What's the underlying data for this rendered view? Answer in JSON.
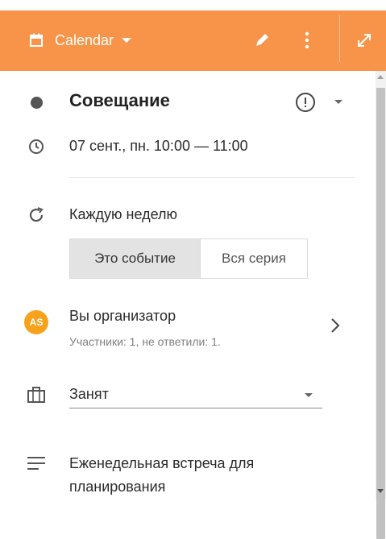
{
  "header": {
    "calendar_label": "Calendar",
    "accent_color": "#f7944a"
  },
  "event": {
    "title": "Совещание",
    "datetime": "07 сент., пн. 10:00 — 11:00",
    "repeat": "Каждую неделю",
    "scope_options": [
      "Это событие",
      "Вся серия"
    ],
    "scope_selected": "Это событие",
    "organizer": {
      "avatar_initials": "AS",
      "title": "Вы организатор",
      "subtitle": "Участники: 1, не ответили: 1."
    },
    "availability": "Занят",
    "description": "Еженедельная встреча для планирования"
  },
  "icons": {
    "header": [
      "calendar-icon",
      "pencil-icon",
      "more-vertical-icon",
      "expand-icon"
    ],
    "rows": [
      "status-dot",
      "info-icon",
      "clock-icon",
      "repeat-icon",
      "briefcase-icon",
      "notes-icon"
    ]
  }
}
